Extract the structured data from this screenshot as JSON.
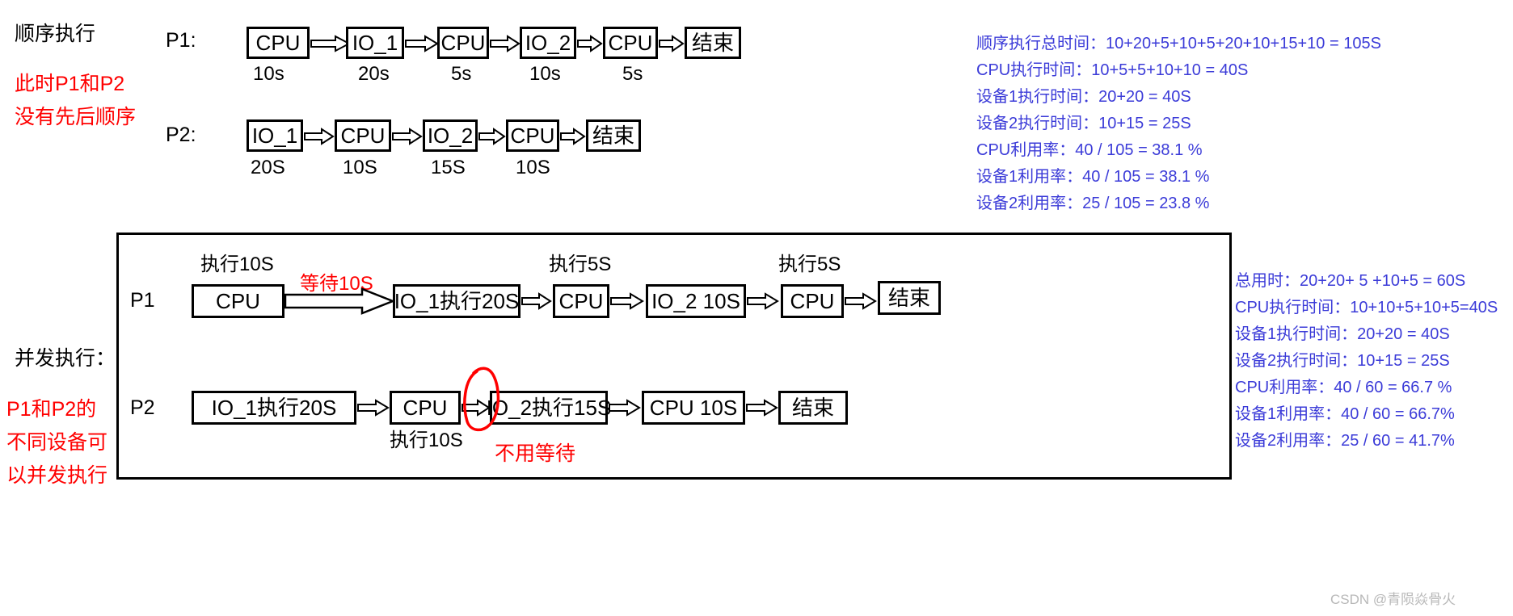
{
  "colors": {
    "text": "#000000",
    "red": "#ff0000",
    "blue": "#3b3bd8",
    "watermark": "#b8b8b8"
  },
  "sequential": {
    "section_label": "顺序执行",
    "note_lines": [
      "此时P1和P2",
      "没有先后顺序"
    ],
    "p1": {
      "name": "P1:",
      "nodes": [
        "CPU",
        "IO_1",
        "CPU",
        "IO_2",
        "CPU",
        "结束"
      ],
      "durations": [
        "10s",
        "20s",
        "5s",
        "10s",
        "5s"
      ]
    },
    "p2": {
      "name": "P2:",
      "nodes": [
        "IO_1",
        "CPU",
        "IO_2",
        "CPU",
        "结束"
      ],
      "durations": [
        "20S",
        "10S",
        "15S",
        "10S"
      ]
    },
    "stats": [
      "顺序执行总时间：10+20+5+10+5+20+10+15+10 = 105S",
      "CPU执行时间：10+5+5+10+10 = 40S",
      "设备1执行时间：20+20 = 40S",
      "设备2执行时间：10+15 = 25S",
      "CPU利用率：40 / 105 = 38.1 %",
      "设备1利用率：40 / 105 = 38.1 %",
      "设备2利用率：25 / 105 = 23.8 %"
    ]
  },
  "concurrent": {
    "section_label": "并发执行：",
    "note_lines": [
      "P1和P2的",
      "不同设备可",
      "以并发执行"
    ],
    "p1": {
      "name": "P1",
      "nodes": [
        "CPU",
        "IO_1执行20S",
        "CPU",
        "IO_2 10S",
        "CPU",
        "结束"
      ],
      "caption_above_cpu1": "执行10S",
      "caption_wait": "等待10S",
      "caption_above_cpu2": "执行5S",
      "caption_above_cpu3": "执行5S"
    },
    "p2": {
      "name": "P2",
      "nodes": [
        "IO_1执行20S",
        "CPU",
        "IO_2执行15S",
        "CPU 10S",
        "结束"
      ],
      "caption_below_cpu": "执行10S",
      "annotation_no_wait": "不用等待"
    },
    "stats": [
      "总用时：20+20+ 5 +10+5 = 60S",
      "CPU执行时间：10+10+5+10+5=40S",
      "设备1执行时间：20+20 = 40S",
      "设备2执行时间：10+15 = 25S",
      "CPU利用率：40 / 60 = 66.7 %",
      "设备1利用率：40 / 60 = 66.7%",
      "设备2利用率：25 / 60 = 41.7%"
    ]
  },
  "watermark": "CSDN @青陨焱骨火"
}
